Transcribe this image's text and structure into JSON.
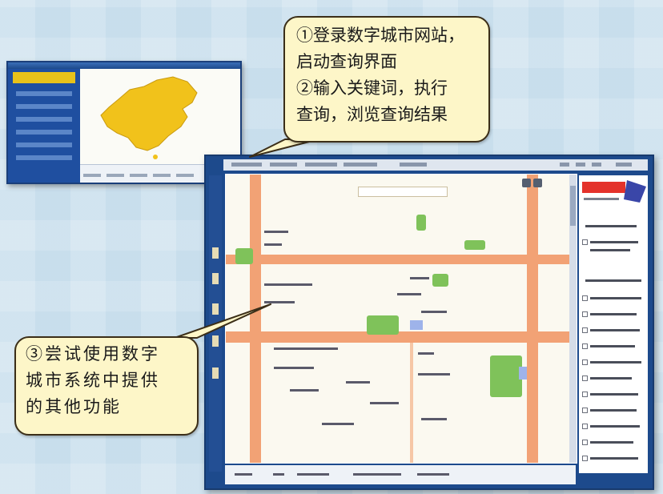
{
  "callouts": {
    "top": {
      "lines": [
        "①登录数字城市网站，",
        "启动查询界面",
        "②输入关键词，执行",
        "查询，浏览查询结果"
      ]
    },
    "bottom": {
      "lines": [
        "③尝试使用数字",
        "城市系统中提供",
        "的其他功能"
      ]
    }
  },
  "colors": {
    "callout_fill": "#fdf6c8",
    "callout_border": "#3b2e18",
    "window_frame": "#1d4a8c",
    "street": "#f2a275",
    "park": "#7fc25a",
    "china_map": "#f1c21b"
  },
  "icons": {
    "china_map": "china-map-icon",
    "right_panel_logo": "city-logo-icon"
  }
}
